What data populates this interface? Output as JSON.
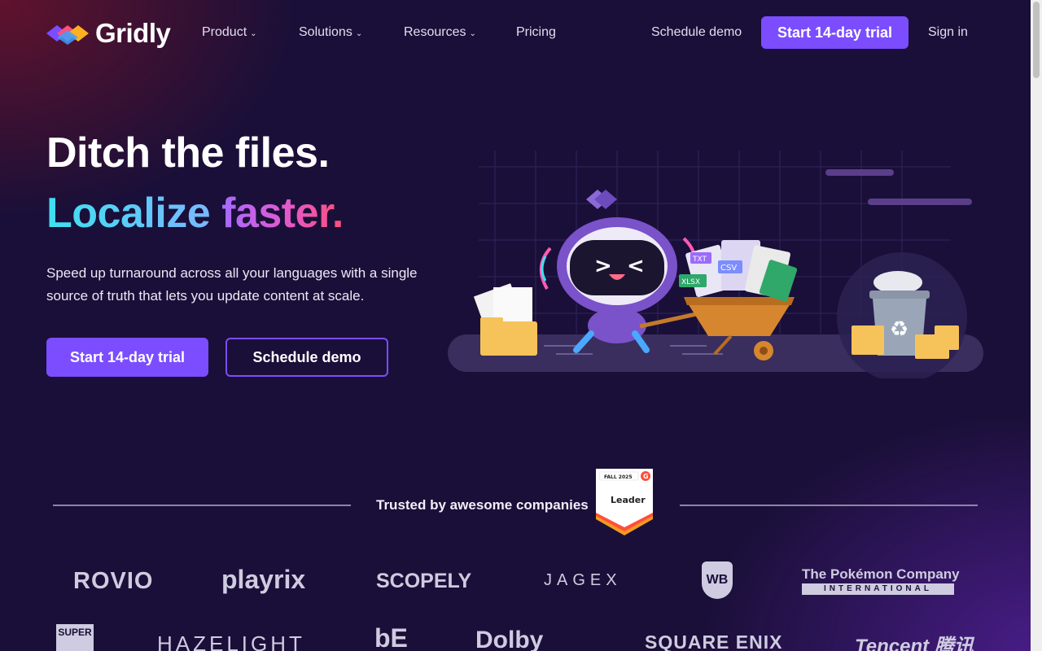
{
  "nav": {
    "brand": "Gridly",
    "items": [
      {
        "label": "Product",
        "chevron": true
      },
      {
        "label": "Solutions",
        "chevron": true
      },
      {
        "label": "Resources",
        "chevron": true
      },
      {
        "label": "Pricing",
        "chevron": false
      }
    ],
    "schedule_demo": "Schedule demo",
    "trial": "Start 14-day trial",
    "signin": "Sign in"
  },
  "hero": {
    "line1": "Ditch the files.",
    "line2_a": "Localize",
    "line2_b": "faster.",
    "subtitle": "Speed up turnaround across all your languages with a single source of truth that lets you update content at scale.",
    "cta_trial": "Start 14-day trial",
    "cta_demo": "Schedule demo",
    "illustration_file_labels": [
      "TXT",
      "CSV",
      "XLSX"
    ]
  },
  "trusted": {
    "heading": "Trusted by awesome companies",
    "badge": {
      "season": "FALL 2025",
      "title": "Leader",
      "brand": "G"
    }
  },
  "companies": {
    "row1": [
      "ROVIO",
      "playrix",
      "SCOPELY",
      "JAGEX",
      "WB",
      "The Pokémon Company",
      "INTERNATIONAL"
    ],
    "row2": [
      "SUPER",
      "HAZELIGHT",
      "bE",
      "Dolby",
      "SQUARE ENIX",
      "Tencent 腾讯"
    ]
  },
  "colors": {
    "accent": "#7b4dff",
    "background": "#1a0f38",
    "gradient_cyan": "#3ee0f0",
    "gradient_pink": "#ff4f7a"
  }
}
